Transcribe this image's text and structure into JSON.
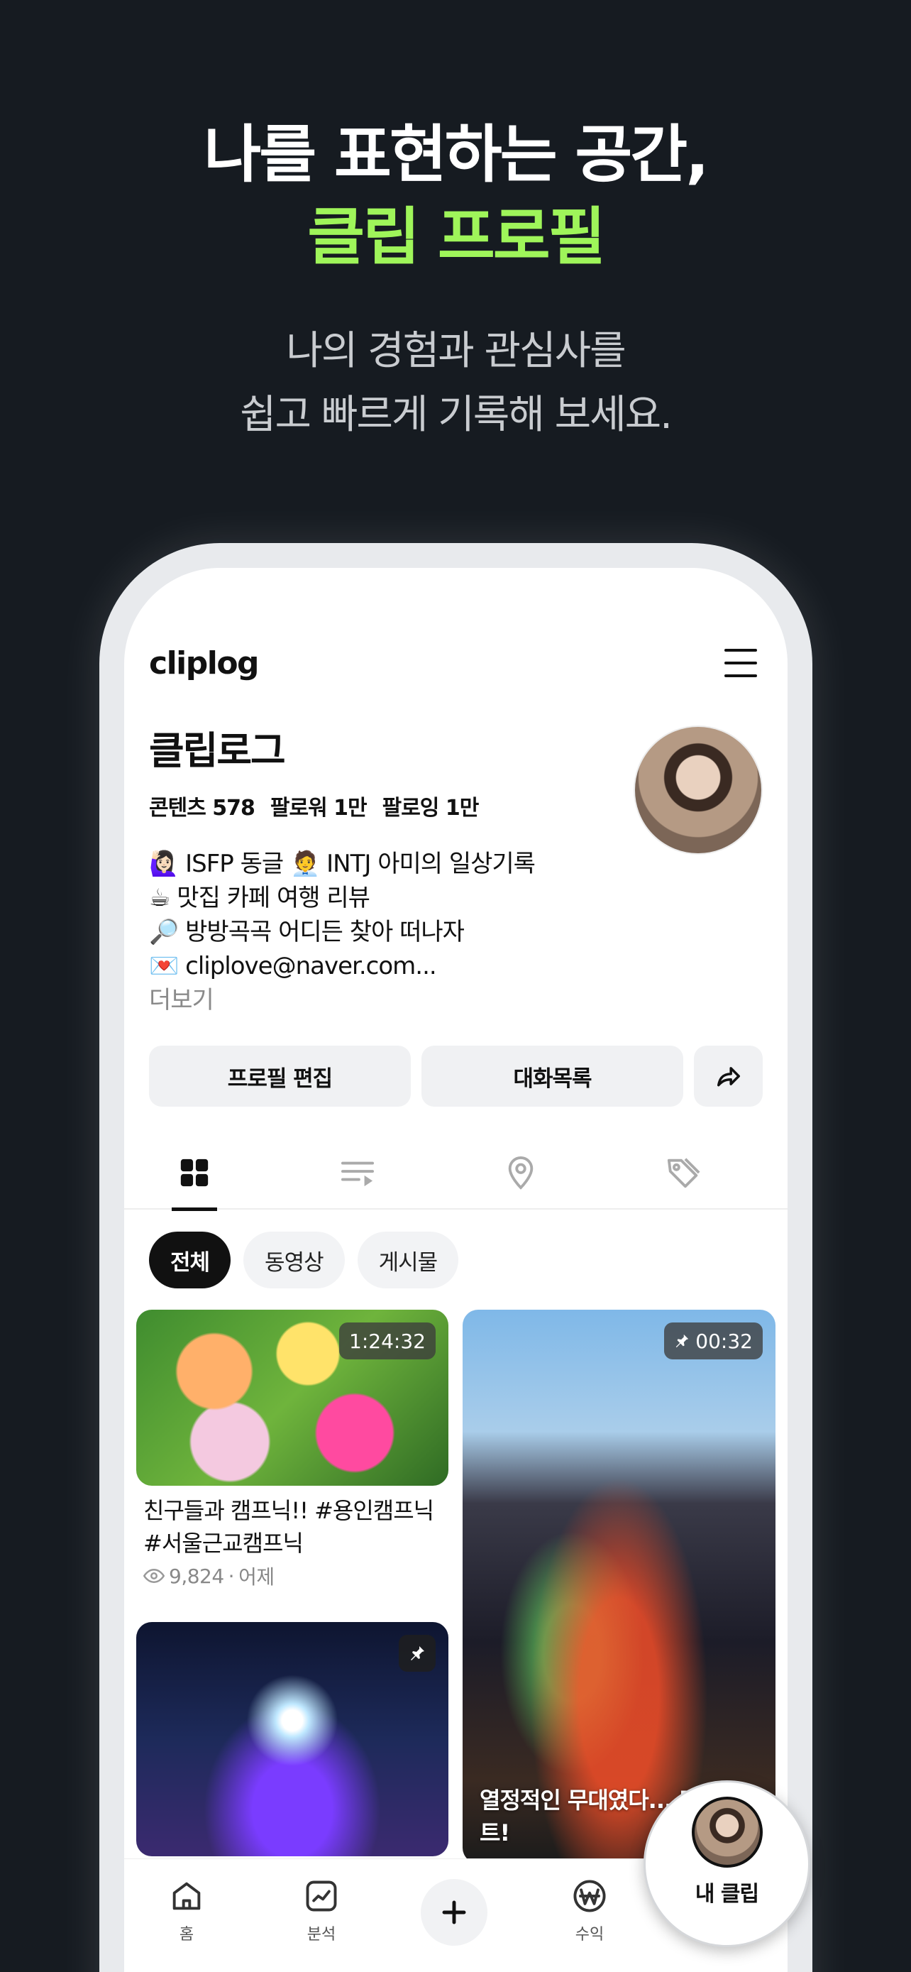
{
  "hero": {
    "title_line1": "나를 표현하는 공간,",
    "title_line2": "클립 프로필",
    "subtitle_line1": "나의 경험과 관심사를",
    "subtitle_line2": "쉽고 빠르게 기록해 보세요."
  },
  "app": {
    "logo": "cliplog",
    "menu_icon": "hamburger-menu-icon"
  },
  "profile": {
    "name": "클립로그",
    "stats": [
      "콘텐츠 578",
      "팔로워 1만",
      "팔로잉 1만"
    ],
    "bio": [
      "🙋🏻‍♀️ ISFP 동글 🧑‍💼 INTJ 아미의 일상기록",
      "☕ 맛집 카페 여행 리뷰",
      "🔎 방방곡곡 어디든 찾아 떠나자",
      "💌 cliplove@naver.com..."
    ],
    "more": "더보기"
  },
  "buttons": {
    "edit_profile": "프로필 편집",
    "chat_list": "대화목록",
    "share_icon": "share-arrow-icon"
  },
  "tabs": [
    {
      "icon": "grid-icon",
      "active": true
    },
    {
      "icon": "playlist-icon",
      "active": false
    },
    {
      "icon": "location-pin-icon",
      "active": false
    },
    {
      "icon": "tag-icon",
      "active": false
    }
  ],
  "filters": [
    "전체",
    "동영상",
    "게시물"
  ],
  "cards": [
    {
      "duration": "1:24:32",
      "title": "친구들과 캠프닉!! #용인캠프닉 #서울근교캠프닉",
      "views": "9,824",
      "date": "어제"
    },
    {
      "duration": "00:32",
      "pinned": true,
      "overlay_title": "열정적인 무대였다... 던 콘서트!"
    },
    {
      "pinned": true
    }
  ],
  "bottom_nav": {
    "home": "홈",
    "analytics": "분석",
    "revenue": "수익",
    "my_clip": "내 클립"
  }
}
